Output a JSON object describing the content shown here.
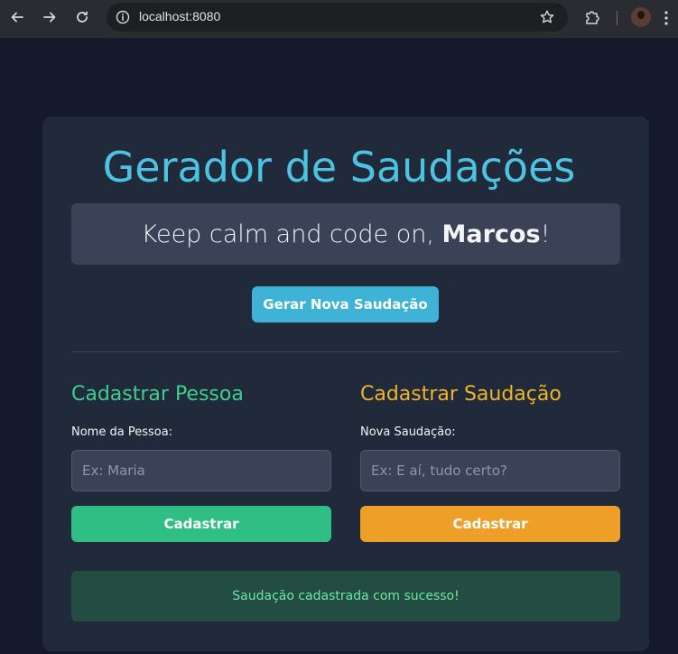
{
  "browser": {
    "url": "localhost:8080",
    "icons": [
      "back-icon",
      "forward-icon",
      "reload-icon",
      "site-info-icon",
      "bookmark-star-icon",
      "extensions-icon",
      "profile-avatar",
      "menu-icon"
    ]
  },
  "page": {
    "title": "Gerador de Saudações",
    "greeting": {
      "prefix": "Keep calm and code on, ",
      "name": "Marcos",
      "suffix": "!"
    },
    "generate_button": "Gerar Nova Saudação",
    "person_section": {
      "title": "Cadastrar Pessoa",
      "label": "Nome da Pessoa:",
      "placeholder": "Ex: Maria",
      "value": "",
      "button": "Cadastrar"
    },
    "greeting_section": {
      "title": "Cadastrar Saudação",
      "label": "Nova Saudação:",
      "placeholder": "Ex: E aí, tudo certo?",
      "value": "",
      "button": "Cadastrar"
    },
    "status_message": "Saudação cadastrada com sucesso!"
  },
  "colors": {
    "background": "#141a2b",
    "card": "#212a3b",
    "title": "#4cc3e0",
    "generate_button": "#3eb3d6",
    "person_accent": "#3ecf8e",
    "greeting_accent": "#f0b429",
    "success_text": "#6ee7a6"
  }
}
